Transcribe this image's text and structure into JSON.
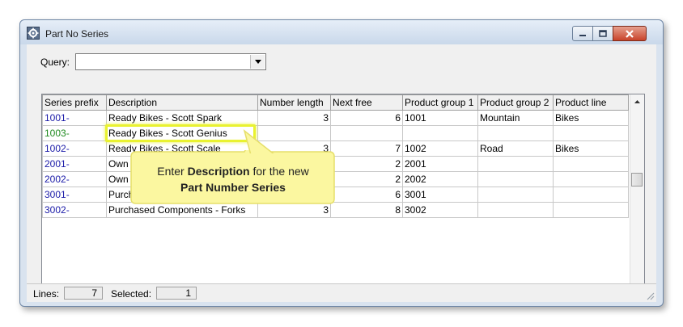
{
  "window": {
    "title": "Part No Series",
    "minimize_icon": "minimize-icon",
    "maximize_icon": "maximize-icon",
    "close_icon": "close-icon"
  },
  "query": {
    "label": "Query:",
    "value": ""
  },
  "grid": {
    "columns": [
      "Series prefix",
      "Description",
      "Number length",
      "Next free",
      "Product group 1",
      "Product group 2",
      "Product line"
    ],
    "rows": [
      {
        "prefix": "1001-",
        "description": "Ready Bikes - Scott Spark",
        "number_length": "3",
        "next_free": "6",
        "group1": "1001",
        "group2": "Mountain",
        "line": "Bikes",
        "prefix_color": "#1a1aa8"
      },
      {
        "prefix": "1003-",
        "description": "Ready Bikes - Scott Genius",
        "number_length": "",
        "next_free": "",
        "group1": "",
        "group2": "",
        "line": "",
        "prefix_color": "#1f8a1f"
      },
      {
        "prefix": "1002-",
        "description": "Ready Bikes - Scott Scale",
        "number_length": "3",
        "next_free": "7",
        "group1": "1002",
        "group2": "Road",
        "line": "Bikes",
        "prefix_color": "#1a1aa8"
      },
      {
        "prefix": "2001-",
        "description": "Own C",
        "number_length": "",
        "next_free": "2",
        "group1": "2001",
        "group2": "",
        "line": "",
        "prefix_color": "#1a1aa8"
      },
      {
        "prefix": "2002-",
        "description": "Own C",
        "number_length": "",
        "next_free": "2",
        "group1": "2002",
        "group2": "",
        "line": "",
        "prefix_color": "#1a1aa8"
      },
      {
        "prefix": "3001-",
        "description": "Purcha",
        "number_length": "",
        "next_free": "6",
        "group1": "3001",
        "group2": "",
        "line": "",
        "prefix_color": "#1a1aa8"
      },
      {
        "prefix": "3002-",
        "description": "Purchased Components - Forks",
        "number_length": "3",
        "next_free": "8",
        "group1": "3002",
        "group2": "",
        "line": "",
        "prefix_color": "#1a1aa8"
      }
    ]
  },
  "status": {
    "lines_label": "Lines:",
    "lines_value": "7",
    "selected_label": "Selected:",
    "selected_value": "1"
  },
  "callout": {
    "text_before": "Enter ",
    "text_bold": "Description",
    "text_after": " for the new",
    "text_line2": "Part Number Series",
    "fill_color": "#fbf7a0"
  }
}
